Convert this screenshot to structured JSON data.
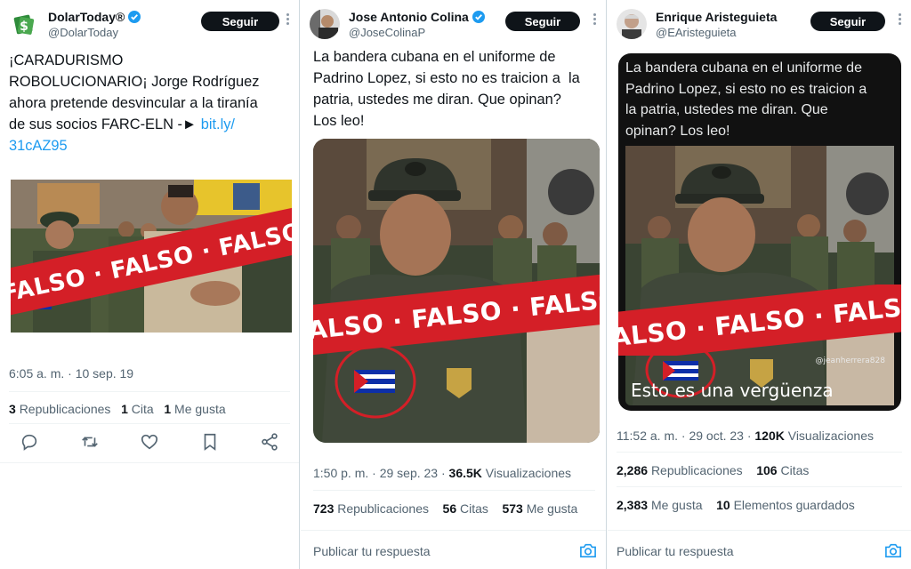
{
  "colors": {
    "accent": "#1d9bf0",
    "banner_red": "#d41f27",
    "text_primary": "#0f1419",
    "text_secondary": "#536471"
  },
  "tweet1": {
    "display_name": "DolarToday®",
    "handle": "@DolarToday",
    "follow_label": "Seguir",
    "text_lines": [
      "¡CARADURISMO",
      "ROBOLUCIONARIO¡ Jorge Rodríguez",
      "ahora pretende desvincular a la tiranía",
      "de sus socios FARC-ELN -►"
    ],
    "link_line1": "bit.ly/",
    "link_line2": "31cAZ95",
    "banner_text": "FALSO · FALSO · FALSO",
    "timestamp": "6:05 a. m. · 10 sep. 19",
    "stats": [
      {
        "value": "3",
        "label": "Republicaciones"
      },
      {
        "value": "1",
        "label": "Cita"
      },
      {
        "value": "1",
        "label": "Me gusta"
      }
    ],
    "actions": [
      "reply-icon",
      "retweet-icon",
      "like-icon",
      "bookmark-icon",
      "share-icon"
    ]
  },
  "tweet2": {
    "display_name": "Jose Antonio Colina",
    "handle": "@JoseColinaP",
    "follow_label": "Seguir",
    "text_lines": [
      "La bandera cubana en el uniforme de",
      "Padrino Lopez, si esto no es traicion a  la",
      "patria, ustedes me diran. Que opinan?",
      "Los leo!"
    ],
    "banner_text": "FALSO · FALSO · FALSO",
    "timestamp": "1:50 p. m. · 29 sep. 23 ·",
    "views_value": "36.5K",
    "views_label": "Visualizaciones",
    "stats": [
      {
        "value": "723",
        "label": "Republicaciones"
      },
      {
        "value": "56",
        "label": "Citas"
      },
      {
        "value": "573",
        "label": "Me gusta"
      }
    ],
    "reply_placeholder": "Publicar tu respuesta"
  },
  "tweet3": {
    "display_name": "Enrique Aristeguieta",
    "handle": "@EAristeguieta",
    "follow_label": "Seguir",
    "image_text_lines": [
      "La bandera cubana en el uniforme de",
      "Padrino Lopez, si esto no es traicion a",
      "la patria, ustedes me diran. Que",
      "opinan? Los leo!"
    ],
    "image_caption": "Esto es una vergüenza",
    "watermark": "@jeanherrera828",
    "banner_text": "FALSO · FALSO · FALSO",
    "timestamp": "11:52 a. m. · 29 oct. 23 ·",
    "views_value": "120K",
    "views_label": "Visualizaciones",
    "stats_row1": [
      {
        "value": "2,286",
        "label": "Republicaciones"
      },
      {
        "value": "106",
        "label": "Citas"
      }
    ],
    "stats_row2": [
      {
        "value": "2,383",
        "label": "Me gusta"
      },
      {
        "value": "10",
        "label": "Elementos guardados"
      }
    ],
    "reply_placeholder": "Publicar tu respuesta"
  }
}
